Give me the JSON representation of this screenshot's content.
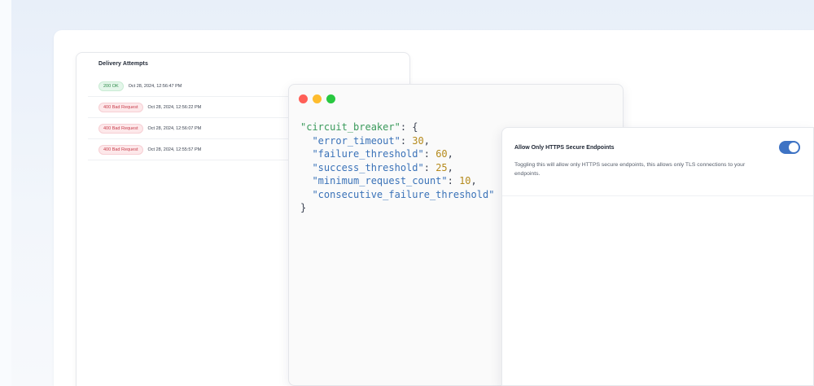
{
  "delivery_attempts": {
    "title": "Delivery Attempts",
    "rows": [
      {
        "status": "200 OK",
        "kind": "ok",
        "time": "Oct 28, 2024, 12:56:47 PM"
      },
      {
        "status": "400 Bad Request",
        "kind": "bad",
        "time": "Oct 28, 2024, 12:56:22 PM"
      },
      {
        "status": "400 Bad Request",
        "kind": "bad",
        "time": "Oct 28, 2024, 12:56:07 PM"
      },
      {
        "status": "400 Bad Request",
        "kind": "bad",
        "time": "Oct 28, 2024, 12:55:57 PM"
      }
    ]
  },
  "code_window": {
    "root_key": "\"circuit_breaker\"",
    "open": ": {",
    "close": "}",
    "entries": [
      {
        "key": "\"error_timeout\"",
        "value": "30",
        "sep": ","
      },
      {
        "key": "\"failure_threshold\"",
        "value": "60",
        "sep": ","
      },
      {
        "key": "\"success_threshold\"",
        "value": "25",
        "sep": ","
      },
      {
        "key": "\"minimum_request_count\"",
        "value": "10",
        "sep": ","
      },
      {
        "key": "\"consecutive_failure_threshold\"",
        "value": "",
        "sep": ""
      }
    ]
  },
  "https_setting": {
    "title": "Allow Only HTTPS Secure Endpoints",
    "description": "Toggling this will allow only HTTPS secure endpoints, this allows only TLS connections to your endpoints.",
    "enabled": true
  },
  "colors": {
    "ok_green": "#2f8a4a",
    "bad_red": "#c8404e",
    "toggle_blue": "#3e73c4"
  }
}
